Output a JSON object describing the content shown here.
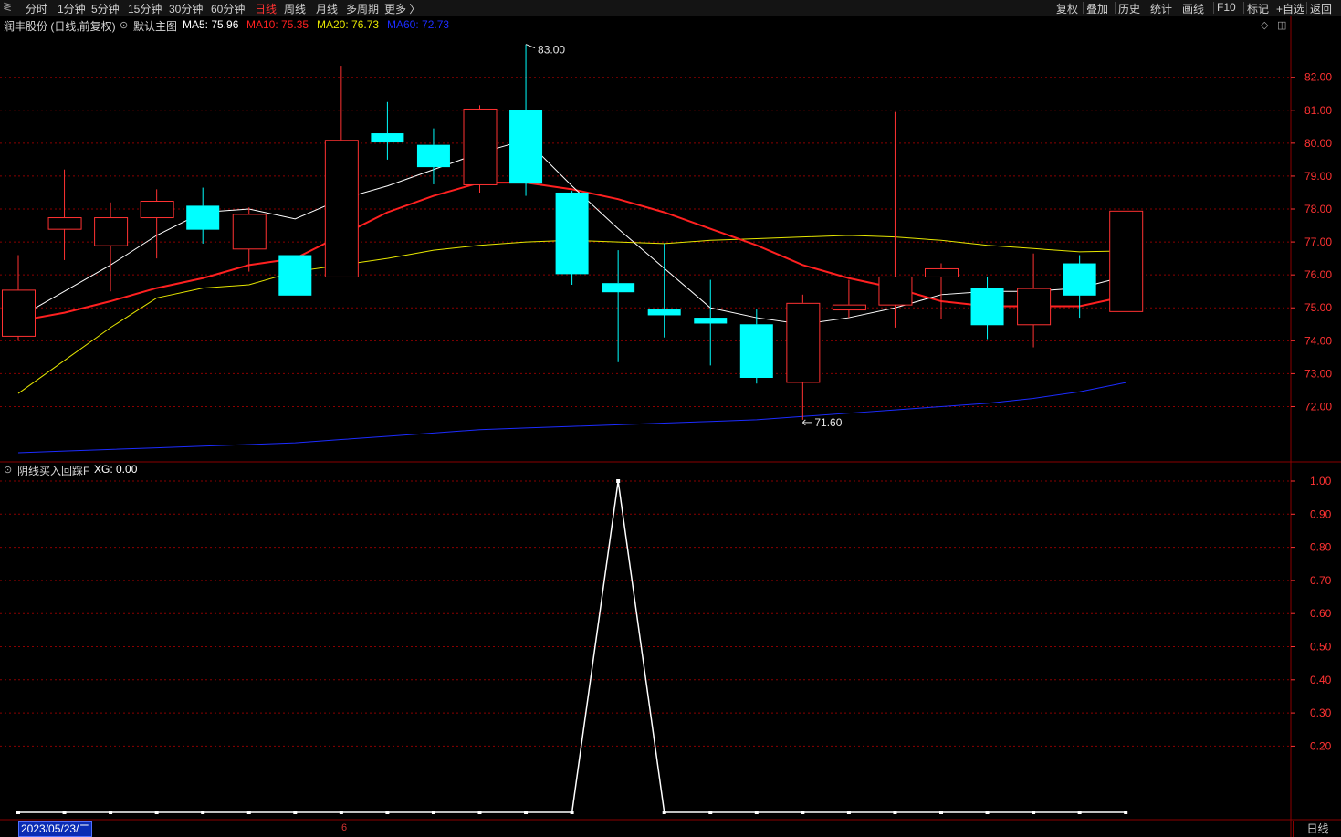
{
  "toolbar": {
    "menu_glyph": "≷",
    "periods": [
      "分时",
      "1分钟",
      "5分钟",
      "15分钟",
      "30分钟",
      "60分钟",
      "日线",
      "周线",
      "月线",
      "多周期",
      "更多 〉"
    ],
    "active_period": "日线",
    "tools": [
      "复权",
      "叠加",
      "历史",
      "统计",
      "画线",
      "F10",
      "标记",
      "+自选",
      "返回"
    ]
  },
  "main_panel": {
    "stock_title": "润丰股份 (日线,前复权)",
    "template_label": "默认主图",
    "ma5": {
      "label": "MA5: 75.96",
      "color": "#ffffff"
    },
    "ma10": {
      "label": "MA10: 75.35",
      "color": "#ff2020"
    },
    "ma20": {
      "label": "MA20: 76.73",
      "color": "#e6e600"
    },
    "ma60": {
      "label": "MA60: 72.73",
      "color": "#1c2cff"
    },
    "high_label": "83.00",
    "low_label": "71.60",
    "ctl_icons": [
      "diamond-icon",
      "panel-icon"
    ]
  },
  "sub_panel": {
    "indicator_name": "阴线买入回踩F",
    "xg_label": "XG: 0.00"
  },
  "footer": {
    "date_label": "2023/05/23/二",
    "month_mark": "6",
    "period_label": "日线"
  },
  "colors": {
    "up": "#ff3232",
    "down": "#00ffff",
    "grid": "#8a0000",
    "axis": "#ff3232",
    "ma5": "#ffffff",
    "ma10": "#ff2020",
    "ma20": "#e6e600",
    "ma60": "#1c2cff"
  },
  "chart_data": [
    {
      "type": "candlestick",
      "title": "润丰股份 (日线,前复权)",
      "y_ticks": [
        72.0,
        73.0,
        74.0,
        75.0,
        76.0,
        77.0,
        78.0,
        79.0,
        80.0,
        81.0,
        82.0
      ],
      "ylim": [
        70.35,
        83.35
      ],
      "candles": [
        {
          "o": 74.15,
          "c": 75.55,
          "h": 76.6,
          "l": 74.0
        },
        {
          "o": 77.4,
          "c": 77.75,
          "h": 79.2,
          "l": 76.45
        },
        {
          "o": 76.9,
          "c": 77.75,
          "h": 78.2,
          "l": 75.5
        },
        {
          "o": 77.75,
          "c": 78.25,
          "h": 78.6,
          "l": 76.5
        },
        {
          "o": 78.1,
          "c": 77.4,
          "h": 78.65,
          "l": 76.95
        },
        {
          "o": 76.8,
          "c": 77.85,
          "h": 78.05,
          "l": 76.1
        },
        {
          "o": 76.6,
          "c": 75.4,
          "h": 76.05,
          "l": 76.25
        },
        {
          "o": 75.95,
          "c": 80.1,
          "h": 82.35,
          "l": 75.95
        },
        {
          "o": 80.3,
          "c": 80.05,
          "h": 81.25,
          "l": 79.5
        },
        {
          "o": 79.95,
          "c": 79.3,
          "h": 80.45,
          "l": 78.75
        },
        {
          "o": 78.75,
          "c": 81.05,
          "h": 81.15,
          "l": 78.5
        },
        {
          "o": 81.0,
          "c": 78.8,
          "h": 83.0,
          "l": 78.4
        },
        {
          "o": 78.5,
          "c": 76.05,
          "h": 78.55,
          "l": 75.7
        },
        {
          "o": 75.75,
          "c": 75.5,
          "h": 76.75,
          "l": 73.35
        },
        {
          "o": 74.95,
          "c": 74.8,
          "h": 76.95,
          "l": 74.1
        },
        {
          "o": 74.7,
          "c": 74.55,
          "h": 75.85,
          "l": 73.25
        },
        {
          "o": 74.5,
          "c": 72.9,
          "h": 74.95,
          "l": 72.7
        },
        {
          "o": 72.75,
          "c": 75.15,
          "h": 75.4,
          "l": 71.6
        },
        {
          "o": 74.95,
          "c": 75.1,
          "h": 75.85,
          "l": 74.7
        },
        {
          "o": 75.1,
          "c": 75.95,
          "h": 80.95,
          "l": 74.4
        },
        {
          "o": 75.95,
          "c": 76.2,
          "h": 76.35,
          "l": 74.65
        },
        {
          "o": 75.6,
          "c": 74.5,
          "h": 75.95,
          "l": 74.05
        },
        {
          "o": 74.5,
          "c": 75.6,
          "h": 76.65,
          "l": 73.8
        },
        {
          "o": 76.35,
          "c": 75.4,
          "h": 76.6,
          "l": 74.7
        },
        {
          "o": 74.9,
          "c": 77.95,
          "h": 77.95,
          "l": 74.9
        }
      ],
      "ma5": [
        74.7,
        75.5,
        76.3,
        77.2,
        77.9,
        78.0,
        77.7,
        78.3,
        78.7,
        79.2,
        79.7,
        80.1,
        78.7,
        77.4,
        76.2,
        75.0,
        74.7,
        74.5,
        74.7,
        75.0,
        75.4,
        75.5,
        75.5,
        75.6,
        75.96
      ],
      "ma10": [
        74.6,
        74.85,
        75.2,
        75.6,
        75.9,
        76.3,
        76.5,
        77.2,
        77.9,
        78.4,
        78.8,
        78.8,
        78.6,
        78.3,
        77.9,
        77.4,
        76.9,
        76.3,
        75.9,
        75.6,
        75.2,
        75.05,
        75.05,
        75.05,
        75.35
      ],
      "ma20": [
        72.4,
        73.4,
        74.4,
        75.3,
        75.6,
        75.7,
        76.1,
        76.3,
        76.5,
        76.75,
        76.9,
        77.0,
        77.05,
        77.0,
        76.95,
        77.05,
        77.1,
        77.15,
        77.2,
        77.15,
        77.05,
        76.9,
        76.8,
        76.7,
        76.73
      ],
      "ma60": [
        70.6,
        70.65,
        70.7,
        70.75,
        70.8,
        70.85,
        70.9,
        71.0,
        71.1,
        71.2,
        71.3,
        71.35,
        71.4,
        71.45,
        71.5,
        71.55,
        71.6,
        71.7,
        71.8,
        71.9,
        72.0,
        72.1,
        72.25,
        72.45,
        72.73
      ]
    },
    {
      "type": "line",
      "title": "阴线买入回踩F",
      "y_ticks": [
        0.2,
        0.3,
        0.4,
        0.5,
        0.6,
        0.7,
        0.8,
        0.9,
        1.0
      ],
      "ylim": [
        0.0,
        1.0
      ],
      "series": [
        {
          "name": "XG",
          "values": [
            0,
            0,
            0,
            0,
            0,
            0,
            0,
            0,
            0,
            0,
            0,
            0,
            0,
            1,
            0,
            0,
            0,
            0,
            0,
            0,
            0,
            0,
            0,
            0,
            0
          ]
        }
      ]
    }
  ]
}
